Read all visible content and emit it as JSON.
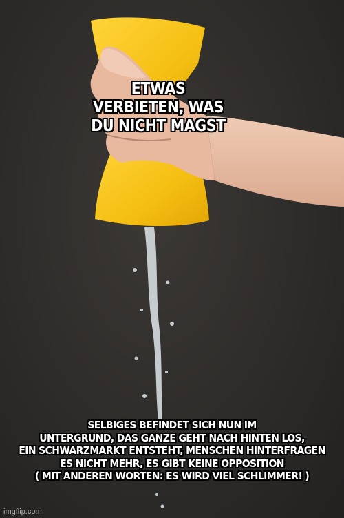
{
  "meme": {
    "top_text": "ETWAS\nVERBIETEN, WAS\nDU NICHT MAGST",
    "bottom_text": "SELBIGES BEFINDET SICH NUN IM\nUNTERGRUND, DAS GANZE GEHT NACH HINTEN LOS,\nEIN SCHWARZMARKT ENTSTEHT, MENSCHEN HINTERFRAGEN\nES NICHT MEHR, ES GIBT KEINE OPPOSITION\n( MIT ANDEREN WORTEN: ES WIRD VIEL SCHLIMMER! )",
    "watermark": "imgflip.com"
  },
  "colors": {
    "background": "#2e2c2a",
    "sponge": "#f6c21a",
    "skin": "#e9bfa7",
    "water": "#dfe6ea"
  }
}
